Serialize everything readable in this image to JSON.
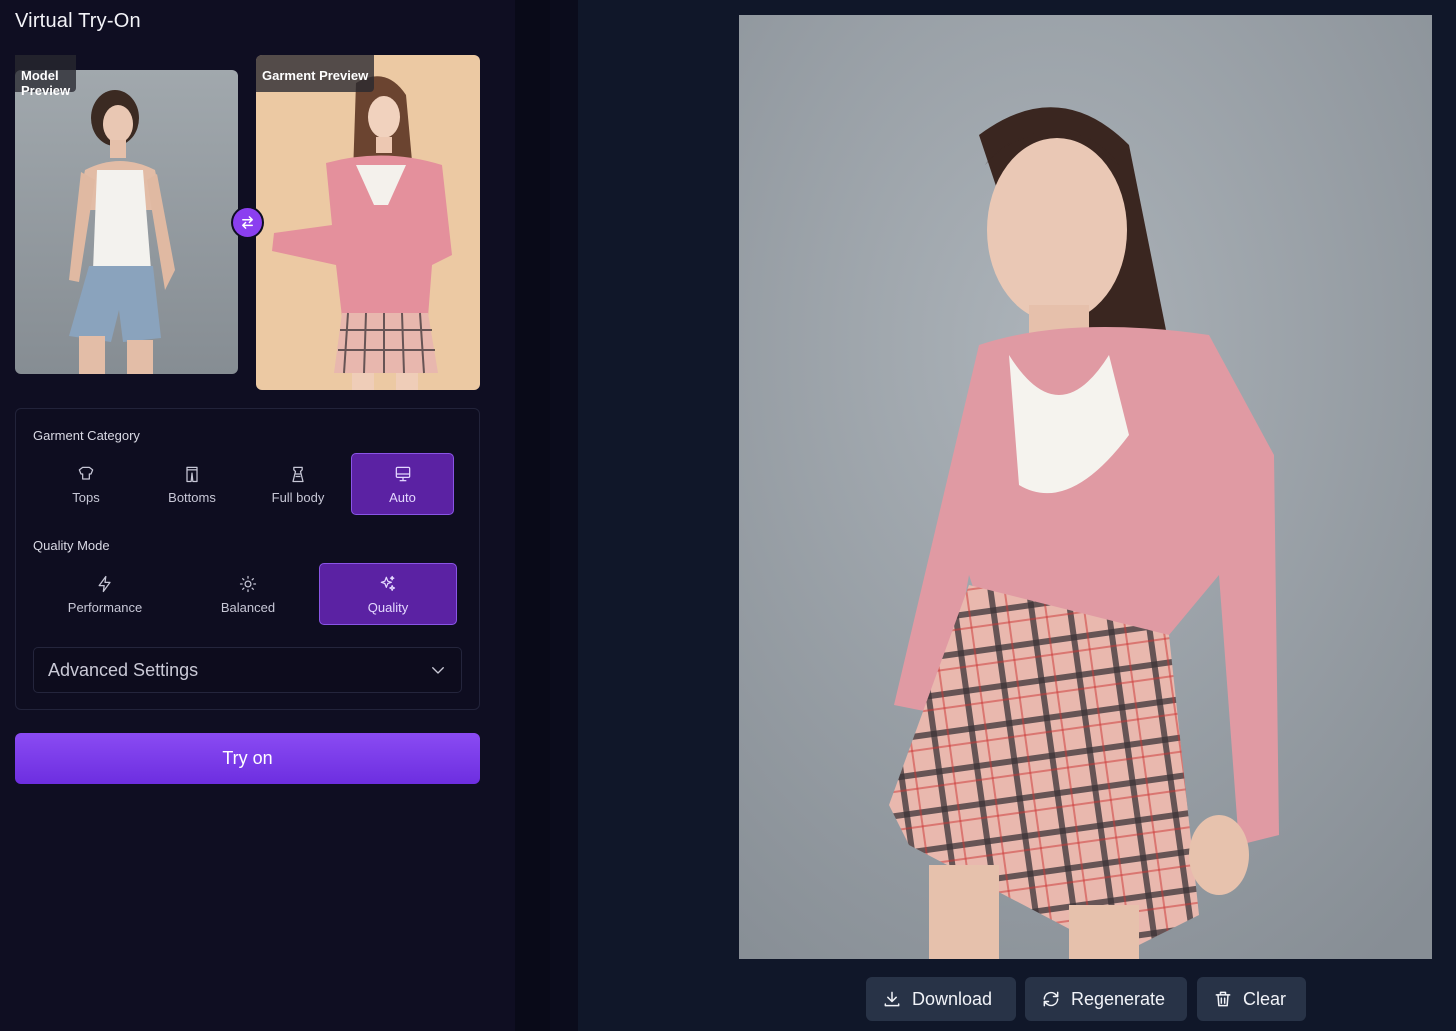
{
  "app": {
    "title": "Virtual Try-On"
  },
  "previews": {
    "model_label": "Model Preview",
    "garment_label": "Garment Preview"
  },
  "garment_category": {
    "label": "Garment Category",
    "options": [
      {
        "label": "Tops",
        "icon": "shirt-icon"
      },
      {
        "label": "Bottoms",
        "icon": "pants-icon"
      },
      {
        "label": "Full body",
        "icon": "dress-icon"
      },
      {
        "label": "Auto",
        "icon": "monitor-icon",
        "selected": true
      }
    ]
  },
  "quality_mode": {
    "label": "Quality Mode",
    "options": [
      {
        "label": "Performance",
        "icon": "lightning-icon"
      },
      {
        "label": "Balanced",
        "icon": "sun-icon"
      },
      {
        "label": "Quality",
        "icon": "sparkles-icon",
        "selected": true
      }
    ]
  },
  "advanced": {
    "label": "Advanced Settings"
  },
  "actions": {
    "tryon_label": "Try on",
    "download_label": "Download",
    "regenerate_label": "Regenerate",
    "clear_label": "Clear"
  },
  "colors": {
    "accent": "#8b3ff0",
    "selected_bg": "#5b22a3",
    "panel_bg": "#0f0e22",
    "result_bg": "#101729"
  }
}
